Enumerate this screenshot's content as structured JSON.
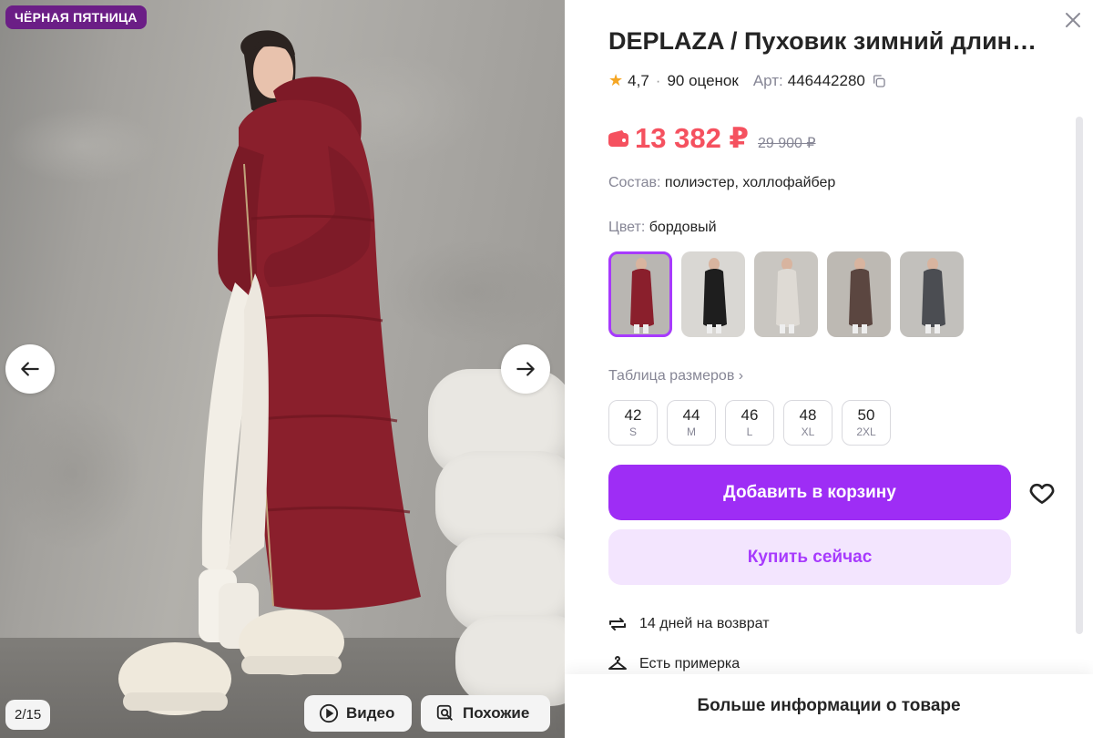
{
  "photo": {
    "badge": "ЧЁРНАЯ ПЯТНИЦА",
    "counter": "2/15",
    "video_label": "Видео",
    "similar_label": "Похожие"
  },
  "product": {
    "title": "DEPLAZA / Пуховик зимний длин…",
    "rating": "4,7",
    "reviews": "90 оценок",
    "article_label": "Арт:",
    "article": "446442280",
    "price": "13 382 ₽",
    "old_price": "29 900 ₽",
    "composition_label": "Состав:",
    "composition": "полиэстер, холлофайбер",
    "color_label": "Цвет:",
    "color": "бордовый",
    "size_table": "Таблица размеров ›"
  },
  "swatches": [
    {
      "coat": "#8a1f2c",
      "bg": "#b9b6b2"
    },
    {
      "coat": "#1e1e1e",
      "bg": "#d9d7d3"
    },
    {
      "coat": "#dedad4",
      "bg": "#c9c6c1"
    },
    {
      "coat": "#5b4640",
      "bg": "#bdb9b3"
    },
    {
      "coat": "#4b4d52",
      "bg": "#c2c0bc"
    }
  ],
  "sizes": [
    {
      "n": "42",
      "l": "S"
    },
    {
      "n": "44",
      "l": "M"
    },
    {
      "n": "46",
      "l": "L"
    },
    {
      "n": "48",
      "l": "XL"
    },
    {
      "n": "50",
      "l": "2XL"
    }
  ],
  "actions": {
    "add_to_cart": "Добавить в корзину",
    "buy_now": "Купить сейчас"
  },
  "features": {
    "returns": "14 дней на возврат",
    "fitting": "Есть примерка"
  },
  "more_info": "Больше информации о товаре",
  "colors": {
    "accent": "#a73afd",
    "cart_button": "#9e2df5",
    "price": "#f5515f",
    "badge": "#6b1e86"
  }
}
